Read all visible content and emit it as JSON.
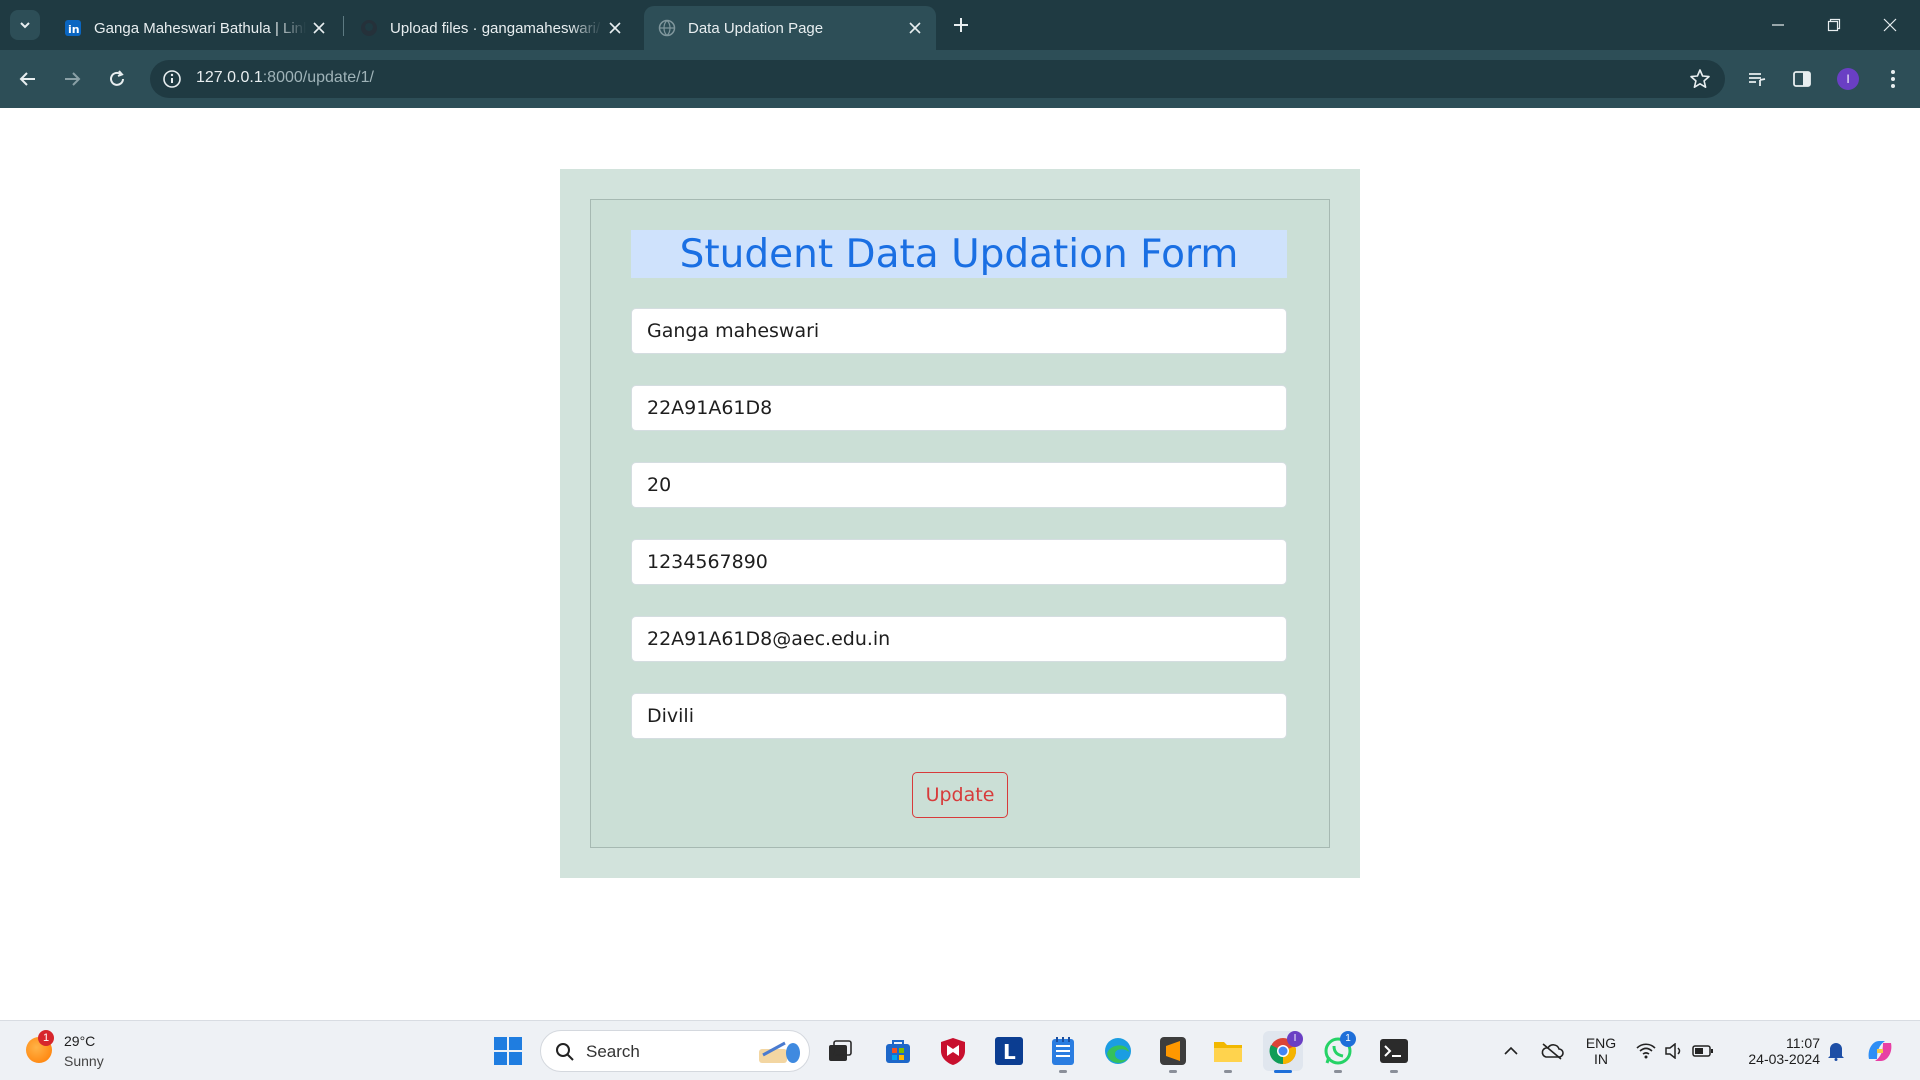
{
  "browser": {
    "tabs": [
      {
        "title": "Ganga Maheswari Bathula | LinkedIn",
        "icon": "linkedin-icon"
      },
      {
        "title": "Upload files · gangamaheswari/",
        "icon": "github-icon"
      },
      {
        "title": "Data Updation Page",
        "icon": "globe-icon"
      }
    ],
    "url_host": "127.0.0.1",
    "url_rest": ":8000/update/1/",
    "profile_initial": "I"
  },
  "form": {
    "heading": "Student Data Updation Form",
    "fields": [
      {
        "value": "Ganga maheswari"
      },
      {
        "value": "22A91A61D8"
      },
      {
        "value": "20"
      },
      {
        "value": "1234567890"
      },
      {
        "value": "22A91A61D8@aec.edu.in"
      },
      {
        "value": "Divili"
      }
    ],
    "submit_label": "Update",
    "colors": {
      "heading": "#1a6fe3",
      "heading_bg": "#cfe2fc",
      "button": "#d73b3b",
      "panel": "#d2e3dc"
    }
  },
  "taskbar": {
    "weather_badge": "1",
    "temperature": "29°C",
    "condition": "Sunny",
    "search_label": "Search",
    "whatsapp_badge": "1",
    "chrome_badge": "I",
    "lang_top": "ENG",
    "lang_bottom": "IN",
    "time": "11:07",
    "date": "24-03-2024"
  }
}
